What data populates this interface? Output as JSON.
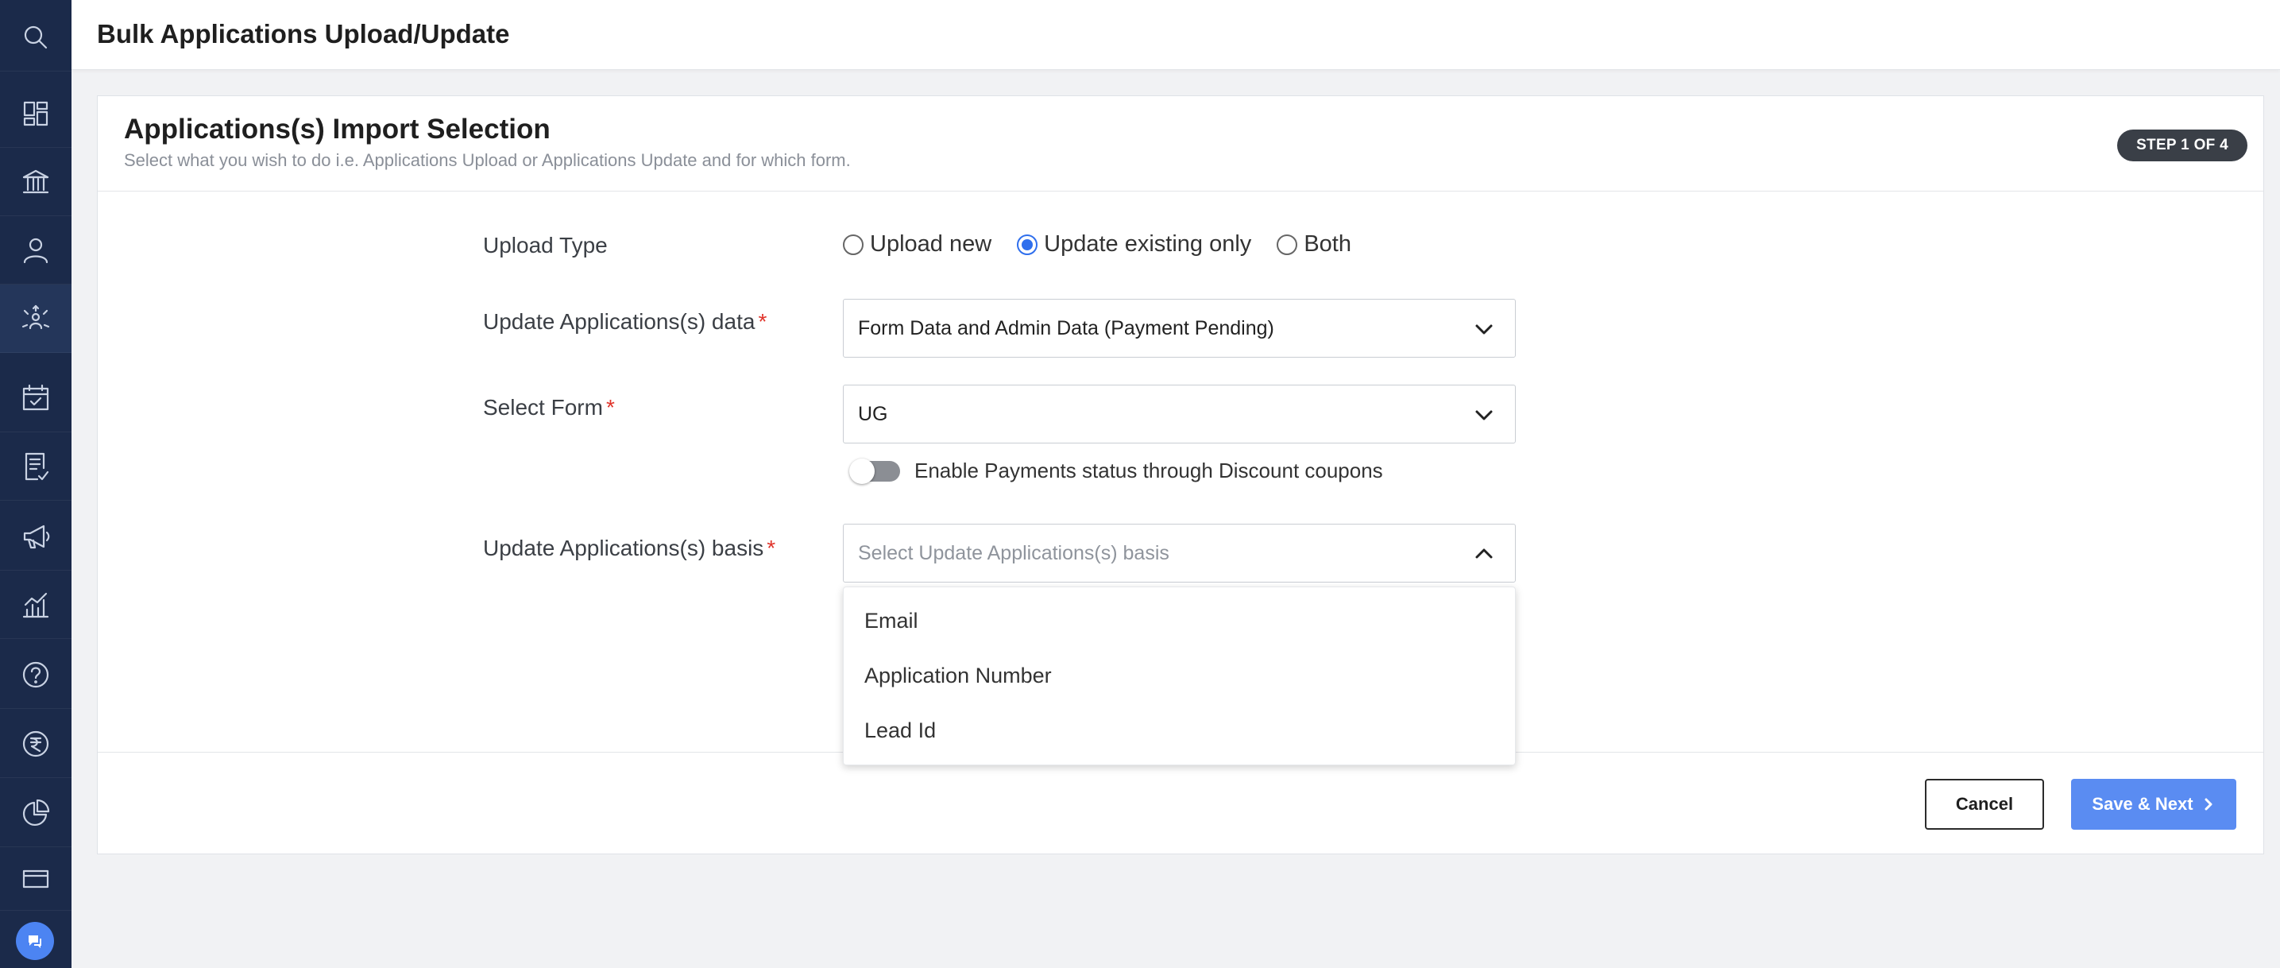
{
  "header": {
    "title": "Bulk Applications Upload/Update"
  },
  "sidebar": {
    "icons": [
      "search-icon",
      "dashboard-icon",
      "institution-icon",
      "user-icon",
      "leads-distribution-icon",
      "calendar-check-icon",
      "checklist-icon",
      "megaphone-icon",
      "analytics-icon",
      "help-icon",
      "rupee-icon",
      "pie-chart-icon",
      "card-icon"
    ],
    "active": "leads-distribution-icon"
  },
  "card": {
    "title": "Applications(s) Import Selection",
    "subtitle": "Select what you wish to do i.e. Applications Upload or Applications Update and for which form.",
    "step": "STEP 1 OF 4"
  },
  "form": {
    "upload_type_label": "Upload Type",
    "upload_options": [
      "Upload new",
      "Update existing only",
      "Both"
    ],
    "upload_selected": "Update existing only",
    "update_data_label": "Update Applications(s) data",
    "update_data_value": "Form Data and Admin Data (Payment Pending)",
    "select_form_label": "Select Form",
    "select_form_value": "UG",
    "toggle_label": "Enable Payments status through Discount coupons",
    "toggle_on": false,
    "basis_label": "Update Applications(s) basis",
    "basis_placeholder": "Select Update Applications(s) basis",
    "basis_options": [
      "Email",
      "Application Number",
      "Lead Id"
    ],
    "required_mark": "*"
  },
  "buttons": {
    "cancel": "Cancel",
    "next": "Save & Next"
  }
}
